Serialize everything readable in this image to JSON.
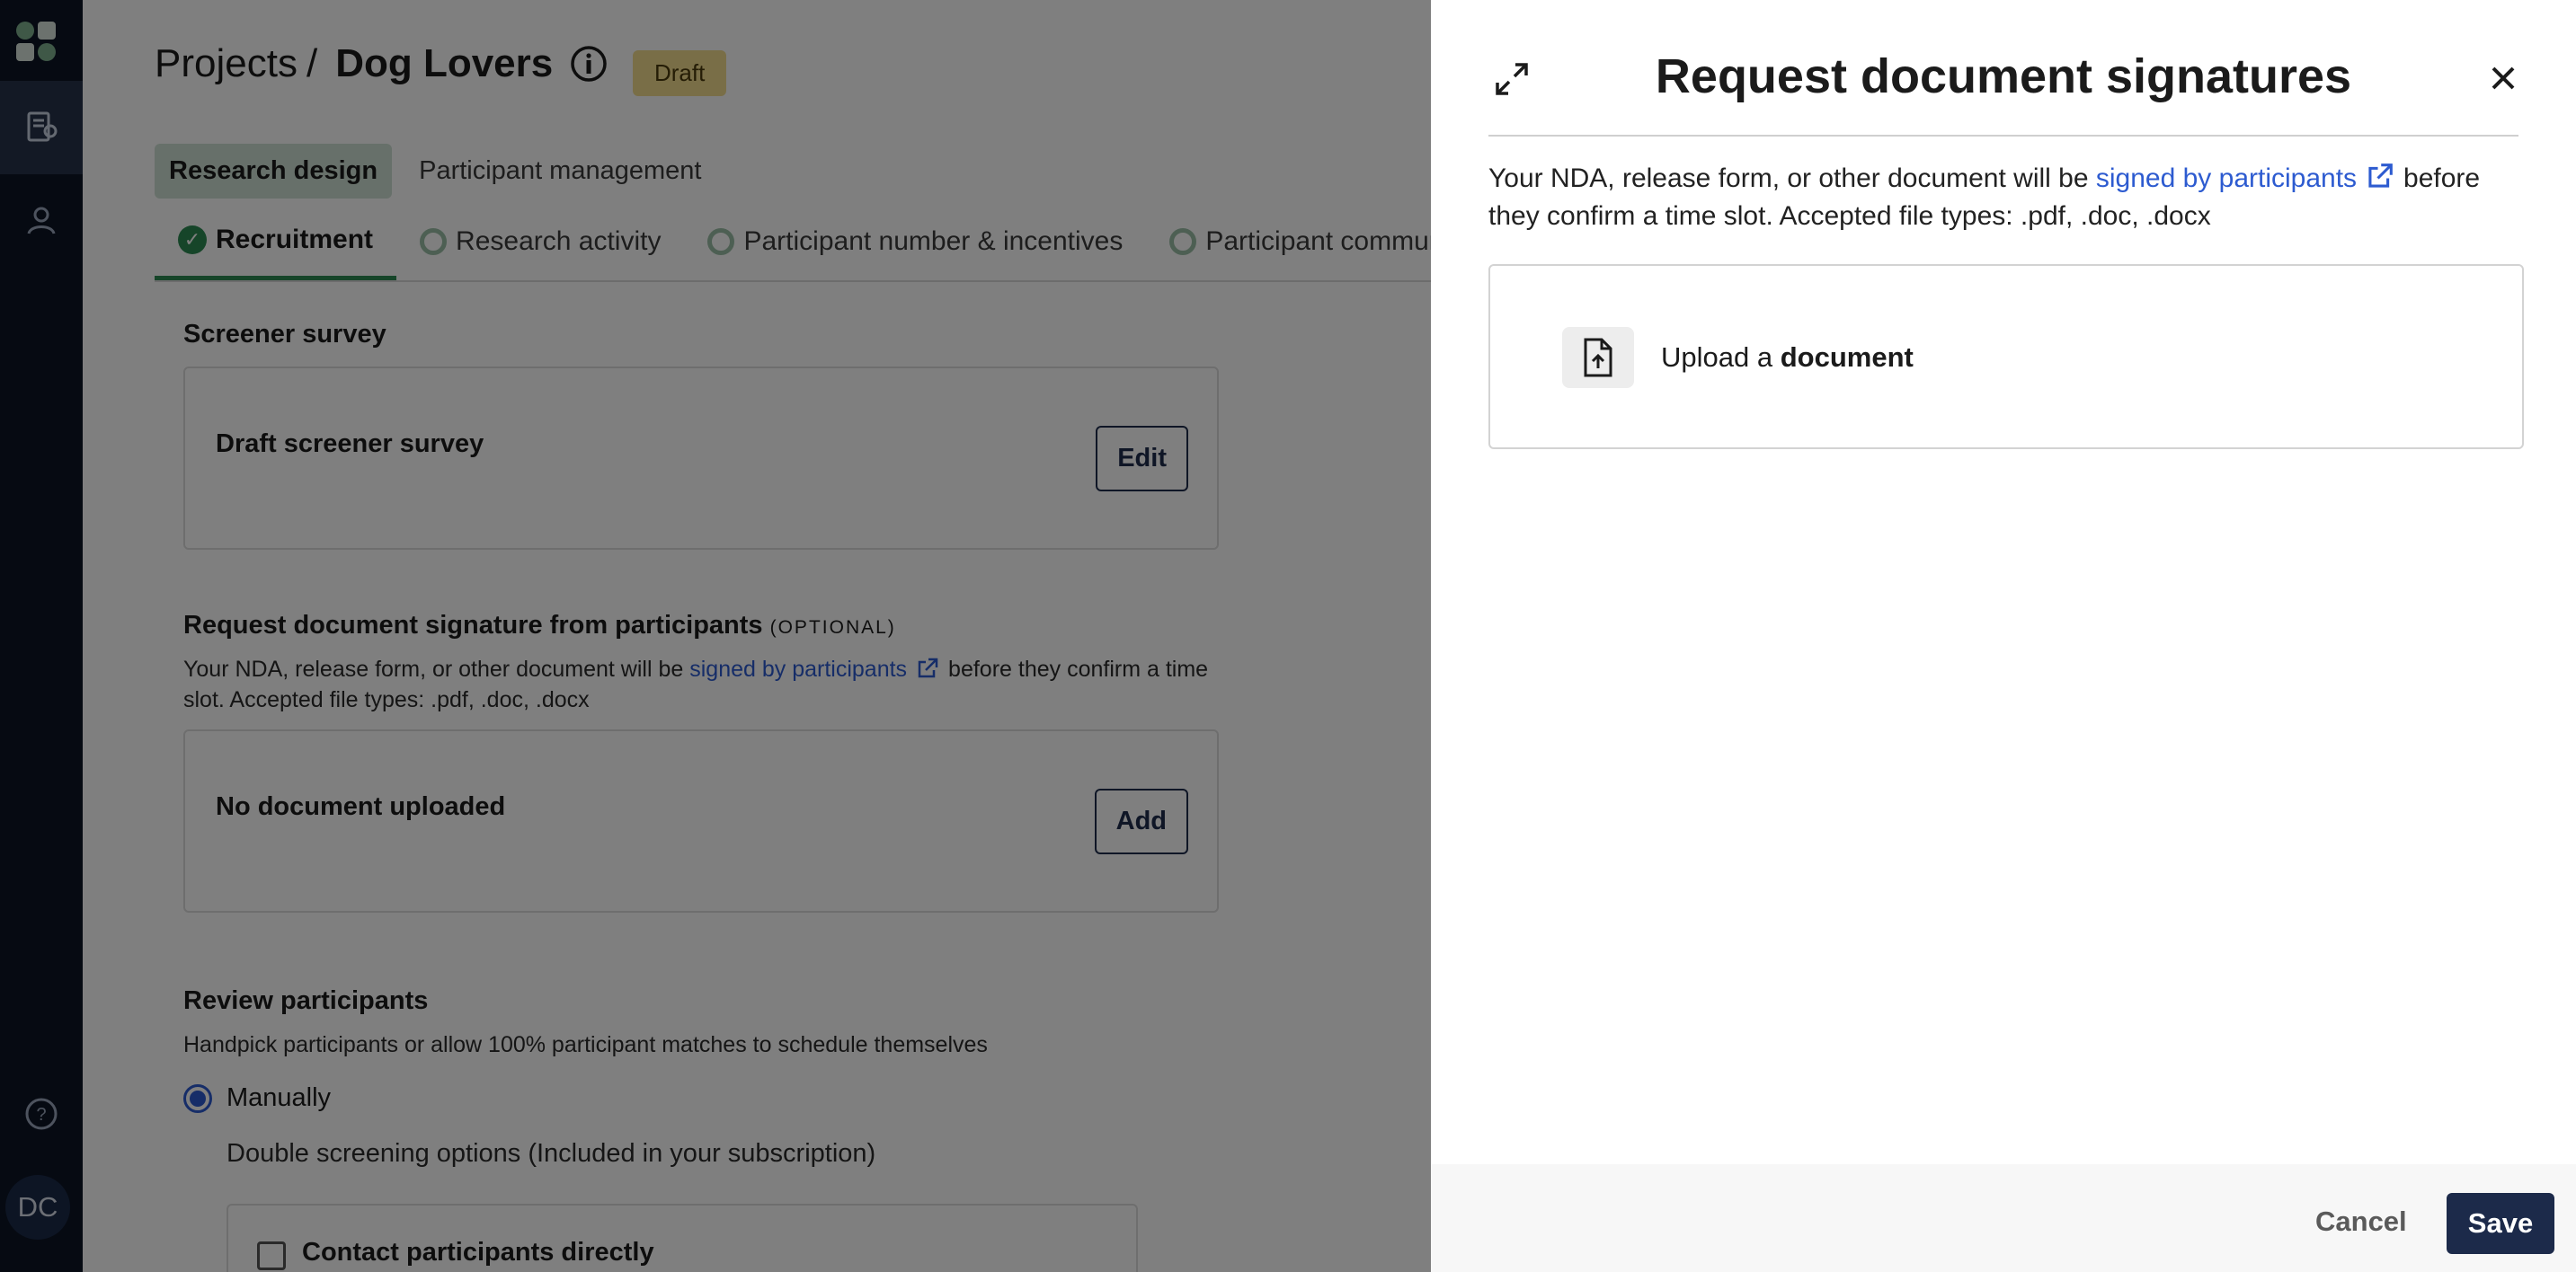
{
  "rail": {
    "avatar_initials": "DC",
    "icons": [
      "app-logo",
      "research-projects-icon",
      "participants-icon",
      "help-icon"
    ]
  },
  "header": {
    "breadcrumb_root": "Projects",
    "breadcrumb_sep": "/",
    "project_title": "Dog Lovers",
    "status_badge": "Draft"
  },
  "top_tabs": [
    {
      "label": "Research design",
      "active": true
    },
    {
      "label": "Participant management",
      "active": false
    }
  ],
  "sub_tabs": [
    {
      "label": "Recruitment",
      "active": true
    },
    {
      "label": "Research activity",
      "active": false
    },
    {
      "label": "Participant number & incentives",
      "active": false
    },
    {
      "label": "Participant communi",
      "active": false
    }
  ],
  "screener": {
    "heading": "Screener survey",
    "card_title": "Draft screener survey",
    "edit_label": "Edit"
  },
  "doc_request": {
    "heading": "Request document signature from participants",
    "optional": "(OPTIONAL)",
    "desc_before": "Your NDA, release form, or other document will be",
    "desc_link": "signed by participants",
    "desc_after": "before they confirm a time slot. Accepted file types: .pdf, .doc, .docx",
    "card_title": "No document uploaded",
    "add_label": "Add"
  },
  "review": {
    "heading": "Review participants",
    "desc": "Handpick participants or allow 100% participant matches to schedule themselves",
    "radio_manually": "Manually",
    "double_screening": "Double screening options  (Included in your subscription)",
    "contact_label": "Contact participants directly"
  },
  "panel": {
    "title": "Request document signatures",
    "desc_before": "Your NDA, release form, or other document will be",
    "desc_link": "signed by participants",
    "desc_after": "before they confirm a time slot. Accepted file types: .pdf, .doc, .docx",
    "upload_prefix": "Upload a",
    "upload_bold": "document",
    "cancel_label": "Cancel",
    "save_label": "Save"
  },
  "colors": {
    "rail_bg": "#0d1424",
    "accent_green": "#2c8a52",
    "link_blue": "#2d5bd0",
    "primary_button": "#1c2a4a",
    "badge_bg": "#f2dc8e"
  }
}
